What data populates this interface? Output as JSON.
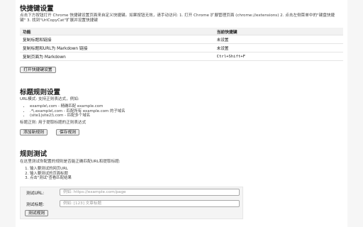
{
  "shortcuts": {
    "title": "快捷键设置",
    "desc": "点击下方按钮打开 Chrome 快捷键设置页面来自定义快捷键。如果按钮无效，请手动访问: 1. 打开 Chrome 扩展管理页面 (chrome://extensions) 2. 点击左侧菜单中的\"键盘快捷键\" 3. 找到\"UrlCopyCat\"扩展并设置快捷键",
    "col_function": "功能",
    "col_shortcut": "当前快捷键",
    "rows": [
      {
        "function": "复制标题和链接",
        "shortcut": "未设置"
      },
      {
        "function": "复制标题和URL为 Markdown 链接",
        "shortcut": "未设置"
      },
      {
        "function": "复制页面为 Markdown",
        "shortcut": "Ctrl+Shift+F"
      }
    ],
    "open_button": "打开快捷键设置"
  },
  "rules": {
    "title": "标题规则设置",
    "intro": "URL模式: 支持正则表达式，例如:",
    "examples": [
      "example\\.com - 精确匹配 example.com",
      ".*\\.example\\.com - 匹配所有 example.com 的子域名",
      "(site1|site2)\\.com - 匹配多个域名"
    ],
    "title_regex": "标题正则: 用于提取标题的正则表达式",
    "add_button": "添加新规则",
    "save_button": "保存规则"
  },
  "test": {
    "title": "规则测试",
    "desc": "在这里测试你配置的规则是否能正确匹配URL和提取标题:",
    "steps": [
      "输入要测试的网页URL",
      "输入要测试的页面标题",
      "点击\"测试\"查看匹配结果"
    ],
    "url_label": "测试URL:",
    "url_placeholder": "例如: https://example.com/page",
    "title_label": "测试标题:",
    "title_placeholder": "例如: [123] 文章标题",
    "test_button": "测试规则"
  }
}
